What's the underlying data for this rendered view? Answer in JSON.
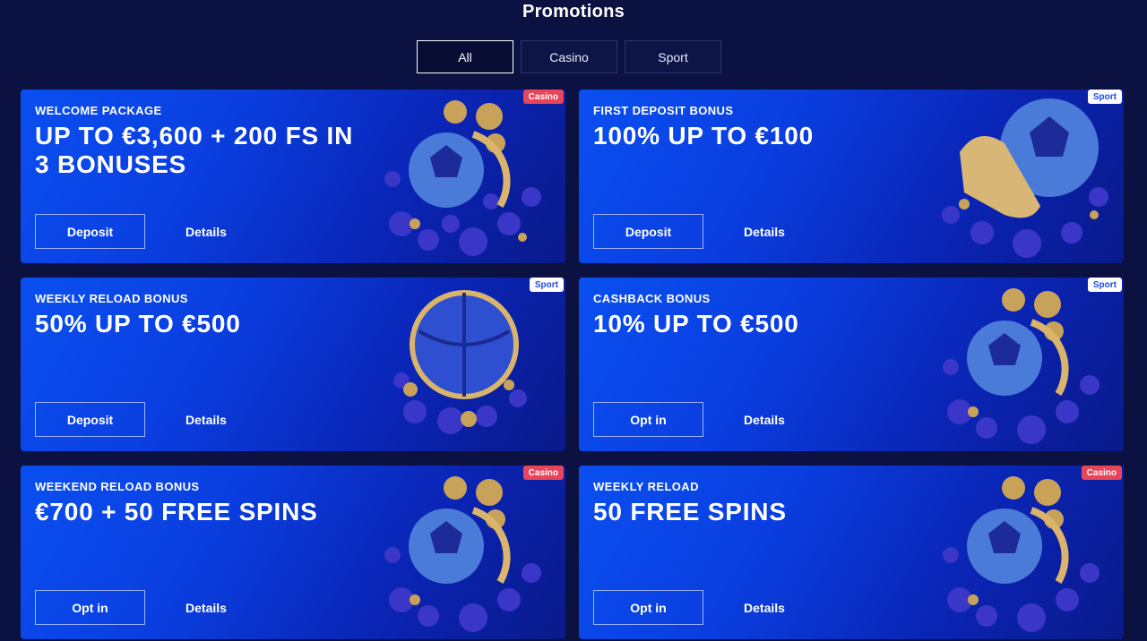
{
  "page": {
    "title": "Promotions"
  },
  "tabs": [
    {
      "label": "All",
      "active": true
    },
    {
      "label": "Casino",
      "active": false
    },
    {
      "label": "Sport",
      "active": false
    }
  ],
  "promos": [
    {
      "category": "Casino",
      "subtitle": "WELCOME PACKAGE",
      "title": "UP TO €3,600 + 200 FS IN 3 BONUSES",
      "primary_button": "Deposit",
      "details_button": "Details",
      "art": "soccer-ball-coins"
    },
    {
      "category": "Sport",
      "subtitle": "FIRST DEPOSIT BONUS",
      "title": "100% UP TO €100",
      "primary_button": "Deposit",
      "details_button": "Details",
      "art": "soccer-ball-boot"
    },
    {
      "category": "Sport",
      "subtitle": "WEEKLY RELOAD BONUS",
      "title": "50% UP TO €500",
      "primary_button": "Deposit",
      "details_button": "Details",
      "art": "basketball"
    },
    {
      "category": "Sport",
      "subtitle": "CASHBACK BONUS",
      "title": "10% UP TO €500",
      "primary_button": "Opt in",
      "details_button": "Details",
      "art": "soccer-ball-coins"
    },
    {
      "category": "Casino",
      "subtitle": "WEEKEND RELOAD BONUS",
      "title": "€700 + 50 FREE SPINS",
      "primary_button": "Opt in",
      "details_button": "Details",
      "art": "soccer-ball-coins"
    },
    {
      "category": "Casino",
      "subtitle": "WEEKLY RELOAD",
      "title": "50 FREE SPINS",
      "primary_button": "Opt in",
      "details_button": "Details",
      "art": "soccer-ball-coins"
    }
  ],
  "colors": {
    "background": "#0b1140",
    "casino_badge": "#e8455a",
    "sport_badge": "#ffffff",
    "card_blue": "#0a4ff0"
  }
}
